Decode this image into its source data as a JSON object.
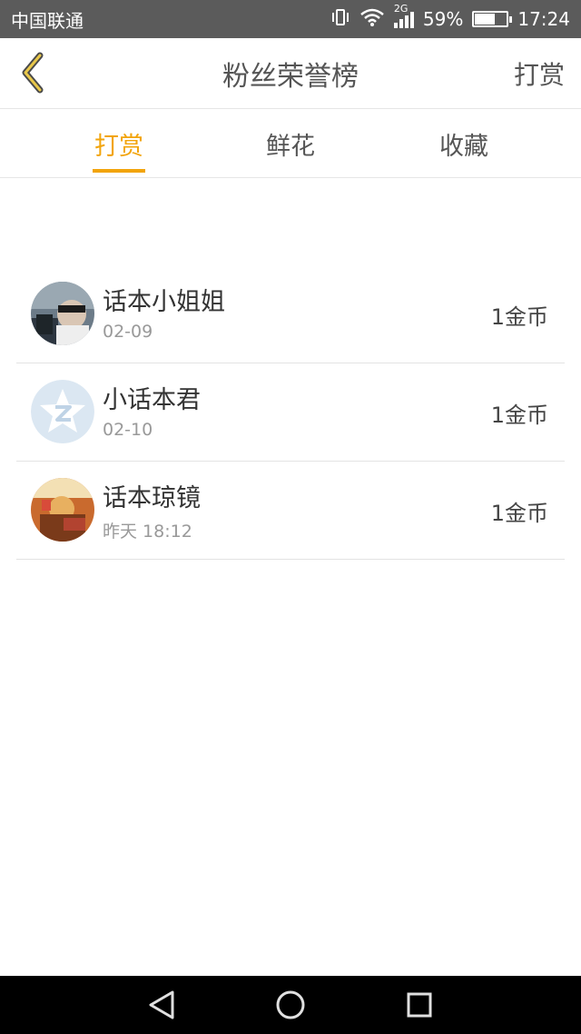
{
  "status": {
    "carrier": "中国联通",
    "network": "2G",
    "battery_percent": "59%",
    "battery_level": 0.59,
    "time": "17:24"
  },
  "header": {
    "title": "粉丝荣誉榜",
    "action_label": "打赏"
  },
  "tabs": [
    {
      "label": "打赏",
      "active": true
    },
    {
      "label": "鲜花",
      "active": false
    },
    {
      "label": "收藏",
      "active": false
    }
  ],
  "fans": [
    {
      "name": "话本小姐姐",
      "date": "02-09",
      "amount": "1金币"
    },
    {
      "name": "小话本君",
      "date": "02-10",
      "amount": "1金币"
    },
    {
      "name": "话本琼镜",
      "date": "昨天 18:12",
      "amount": "1金币"
    }
  ],
  "colors": {
    "accent": "#f2a40b",
    "status_bar": "#5b5b5b",
    "nav_bar": "#000000"
  },
  "icons": {
    "back": "chevron-left-icon",
    "nav_back": "triangle-back-icon",
    "nav_home": "circle-home-icon",
    "nav_recents": "square-recents-icon"
  }
}
